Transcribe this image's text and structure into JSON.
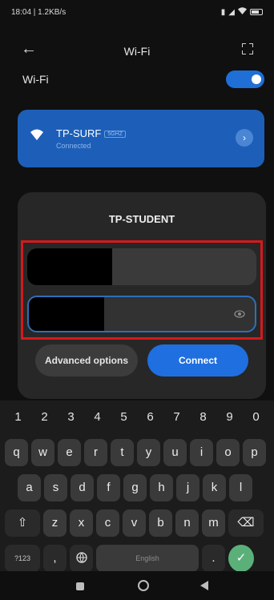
{
  "status_bar": {
    "left": "18:04 | 1.2KB/s",
    "right_icons": [
      "sim-icon",
      "signal-icon",
      "wifi-icon",
      "battery-icon"
    ]
  },
  "header": {
    "title": "Wi-Fi",
    "back_icon": "back-arrow-icon",
    "scan_icon": "qr-scan-icon"
  },
  "wifi_toggle": {
    "label": "Wi-Fi",
    "on": true
  },
  "connected_network": {
    "name": "TP-SURF",
    "tag": "5GHZ",
    "status": "Connected"
  },
  "dialog": {
    "title": "TP-STUDENT",
    "username_value": "",
    "password_value": "",
    "advanced_label": "Advanced options",
    "connect_label": "Connect"
  },
  "keyboard": {
    "numbers": [
      "1",
      "2",
      "3",
      "4",
      "5",
      "6",
      "7",
      "8",
      "9",
      "0"
    ],
    "row1": [
      "q",
      "w",
      "e",
      "r",
      "t",
      "y",
      "u",
      "i",
      "o",
      "p"
    ],
    "row2": [
      "a",
      "s",
      "d",
      "f",
      "g",
      "h",
      "j",
      "k",
      "l"
    ],
    "row3": [
      "z",
      "x",
      "c",
      "v",
      "b",
      "n",
      "m"
    ],
    "symbols_label": "?123",
    "comma_label": ",",
    "space_label": "English",
    "period_label": "."
  },
  "colors": {
    "accent": "#1f6fe0",
    "highlight": "#d6191c",
    "enter": "#5bb07a"
  }
}
